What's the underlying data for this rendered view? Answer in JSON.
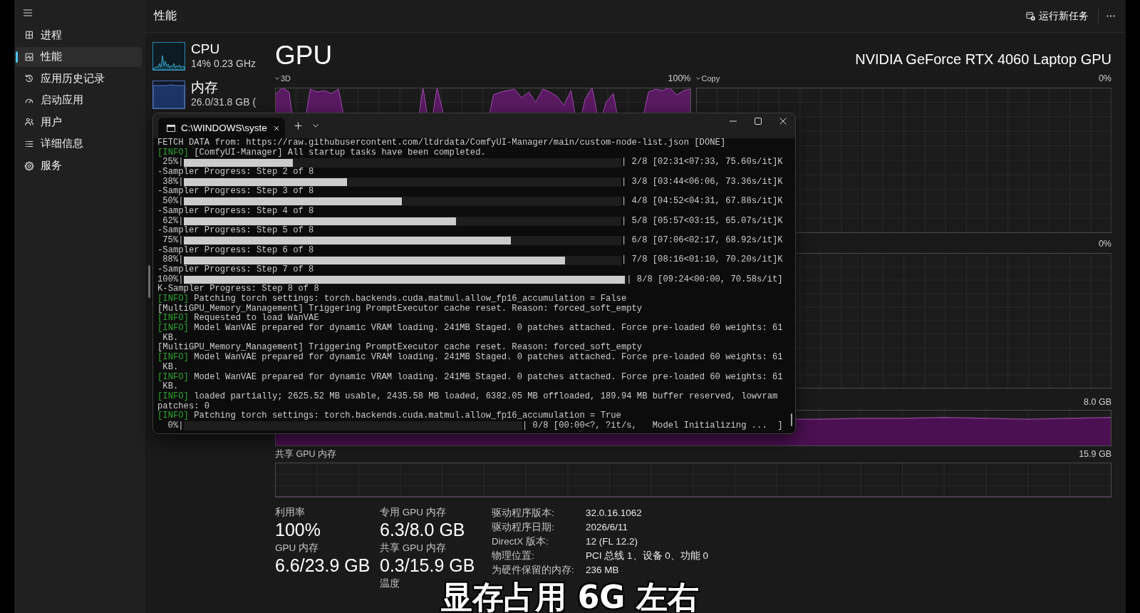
{
  "sidebar": {
    "items": [
      {
        "label": "进程",
        "selected": false
      },
      {
        "label": "性能",
        "selected": true
      },
      {
        "label": "应用历史记录",
        "selected": false
      },
      {
        "label": "启动应用",
        "selected": false
      },
      {
        "label": "用户",
        "selected": false
      },
      {
        "label": "详细信息",
        "selected": false
      },
      {
        "label": "服务",
        "selected": false
      }
    ]
  },
  "header": {
    "title": "性能",
    "run_new_task": "运行新任务"
  },
  "devices": [
    {
      "kind": "cpu",
      "name": "CPU",
      "usage": "14% 0.23 GHz"
    },
    {
      "kind": "memory",
      "name": "内存",
      "usage": "26.0/31.8 GB ("
    }
  ],
  "gpu": {
    "title": "GPU",
    "model": "NVIDIA GeForce RTX 4060 Laptop GPU",
    "engine_graphs": [
      {
        "label": "3D",
        "value": "100%",
        "busy": true
      },
      {
        "label": "Copy",
        "value": "0%",
        "busy": false
      },
      {
        "value": "0%",
        "busy": false
      }
    ],
    "memory_graphs": [
      {
        "max": "8.0 GB",
        "busy": true
      },
      {
        "label": "共享 GPU 内存",
        "max": "15.9 GB",
        "busy": false
      }
    ],
    "stat_columns": [
      [
        {
          "label": "利用率",
          "value": "100%"
        },
        {
          "label": "GPU 内存",
          "value": "6.6/23.9 GB"
        }
      ],
      [
        {
          "label": "专用 GPU 内存",
          "value": "6.3/8.0 GB"
        },
        {
          "label": "共享 GPU 内存",
          "value": "0.3/15.9 GB"
        },
        {
          "label": "温度"
        }
      ]
    ],
    "properties": [
      {
        "label": "驱动程序版本:",
        "value": "32.0.16.1062"
      },
      {
        "label": "驱动程序日期:",
        "value": "2026/6/11"
      },
      {
        "label": "DirectX 版本:",
        "value": "12 (FL 12.2)"
      },
      {
        "label": "物理位置:",
        "value": "PCI 总线 1、设备 0、功能 0"
      },
      {
        "label": "为硬件保留的内存:",
        "value": "236 MB"
      }
    ]
  },
  "terminal": {
    "tabs": [
      {
        "title": "C:\\WINDOWS\\syste",
        "selected": true
      }
    ],
    "lines": [
      {
        "kind": "text",
        "text": "FETCH DATA from: https://raw.githubusercontent.com/ltdrdata/ComfyUI-Manager/main/custom-node-list.json [DONE]"
      },
      {
        "kind": "log",
        "tag": "[INFO]",
        "text": "[ComfyUI-Manager] All startup tasks have been completed."
      },
      {
        "kind": "progress",
        "percent": "25%|",
        "level": 0.25,
        "status": "| 2/8 [02:31<07:33, 75.60s/it]K"
      },
      {
        "kind": "text",
        "text": "-Sampler Progress: Step 2 of 8"
      },
      {
        "kind": "progress",
        "percent": "38%|",
        "level": 0.375,
        "status": "| 3/8 [03:44<06:06, 73.36s/it]K"
      },
      {
        "kind": "text",
        "text": "-Sampler Progress: Step 3 of 8"
      },
      {
        "kind": "progress",
        "percent": "50%|",
        "level": 0.5,
        "status": "| 4/8 [04:52<04:31, 67.88s/it]K"
      },
      {
        "kind": "text",
        "text": "-Sampler Progress: Step 4 of 8"
      },
      {
        "kind": "progress",
        "percent": "62%|",
        "level": 0.625,
        "status": "| 5/8 [05:57<03:15, 65.07s/it]K"
      },
      {
        "kind": "text",
        "text": "-Sampler Progress: Step 5 of 8"
      },
      {
        "kind": "progress",
        "percent": "75%|",
        "level": 0.75,
        "status": "| 6/8 [07:06<02:17, 68.92s/it]K"
      },
      {
        "kind": "text",
        "text": "-Sampler Progress: Step 6 of 8"
      },
      {
        "kind": "progress",
        "percent": "88%|",
        "level": 0.875,
        "status": "| 7/8 [08:16<01:10, 70.20s/it]K"
      },
      {
        "kind": "text",
        "text": "-Sampler Progress: Step 7 of 8"
      },
      {
        "kind": "progress",
        "percent": "100%|",
        "level": 1.0,
        "status": "| 8/8 [09:24<00:00, 70.58s/it]"
      },
      {
        "kind": "text",
        "text": "K-Sampler Progress: Step 8 of 8"
      },
      {
        "kind": "log",
        "tag": "[INFO]",
        "text": "Patching torch settings: torch.backends.cuda.matmul.allow_fp16_accumulation = False"
      },
      {
        "kind": "text",
        "text": "[MultiGPU_Memory_Management] Triggering PromptExecutor cache reset. Reason: forced_soft_empty"
      },
      {
        "kind": "log",
        "tag": "[INFO]",
        "text": "Requested to load WanVAE"
      },
      {
        "kind": "log",
        "tag": "[INFO]",
        "text": "Model WanVAE prepared for dynamic VRAM loading. 241MB Staged. 0 patches attached. Force pre-loaded 60 weights: 61"
      },
      {
        "kind": "text",
        "text": " KB."
      },
      {
        "kind": "text",
        "text": "[MultiGPU_Memory_Management] Triggering PromptExecutor cache reset. Reason: forced_soft_empty"
      },
      {
        "kind": "log",
        "tag": "[INFO]",
        "text": "Model WanVAE prepared for dynamic VRAM loading. 241MB Staged. 0 patches attached. Force pre-loaded 60 weights: 61"
      },
      {
        "kind": "text",
        "text": " KB."
      },
      {
        "kind": "log",
        "tag": "[INFO]",
        "text": "Model WanVAE prepared for dynamic VRAM loading. 241MB Staged. 0 patches attached. Force pre-loaded 60 weights: 61"
      },
      {
        "kind": "text",
        "text": " KB."
      },
      {
        "kind": "log",
        "tag": "[INFO]",
        "text": "loaded partially; 2625.52 MB usable, 2435.58 MB loaded, 6382.05 MB offloaded, 189.94 MB buffer reserved, lowvram"
      },
      {
        "kind": "text",
        "text": "patches: 0"
      },
      {
        "kind": "log",
        "tag": "[INFO]",
        "text": "Patching torch settings: torch.backends.cuda.matmul.allow_fp16_accumulation = True"
      },
      {
        "kind": "progress",
        "percent": "0%|",
        "level": 0,
        "status": "| 0/8 [00:00<?, ?it/s,   Model Initializing ...  ]"
      }
    ]
  },
  "caption": "显存占用 6G 左右"
}
